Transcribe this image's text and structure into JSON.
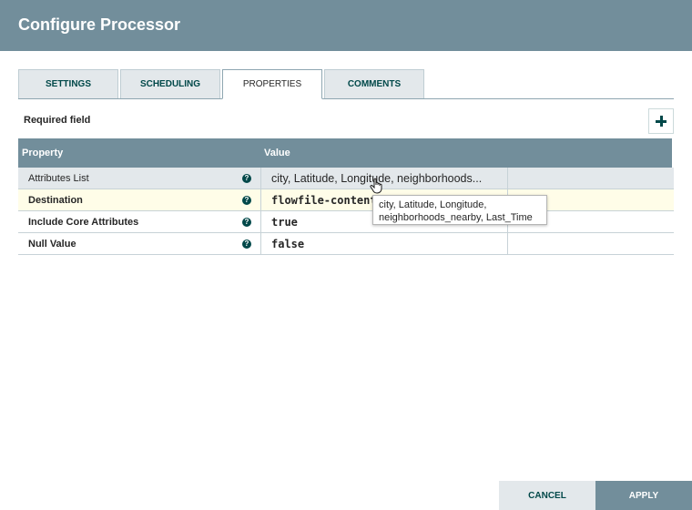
{
  "dialog": {
    "title": "Configure Processor"
  },
  "tabs": [
    {
      "label": "Settings"
    },
    {
      "label": "Scheduling"
    },
    {
      "label": "Properties",
      "active": true
    },
    {
      "label": "Comments"
    }
  ],
  "properties": {
    "required_label": "Required field",
    "add_icon": "plus-icon",
    "columns": {
      "property": "Property",
      "value": "Value"
    },
    "rows": [
      {
        "name": "Attributes List",
        "value": "city, Latitude, Longitude, neighborhoods...",
        "help_icon": "question-icon"
      },
      {
        "name": "Destination",
        "value": "flowfile-content",
        "help_icon": "question-icon"
      },
      {
        "name": "Include Core Attributes",
        "value": "true",
        "help_icon": "question-icon"
      },
      {
        "name": "Null Value",
        "value": "false",
        "help_icon": "question-icon"
      }
    ],
    "tooltip": {
      "line1": "city, Latitude, Longitude,",
      "line2": "neighborhoods_nearby, Last_Time"
    }
  },
  "footer": {
    "cancel_label": "Cancel",
    "apply_label": "Apply"
  },
  "colors": {
    "header": "#728e9b",
    "accent": "#004849",
    "row_selected": "#e3e8eb",
    "row_highlight": "#fffde8"
  }
}
